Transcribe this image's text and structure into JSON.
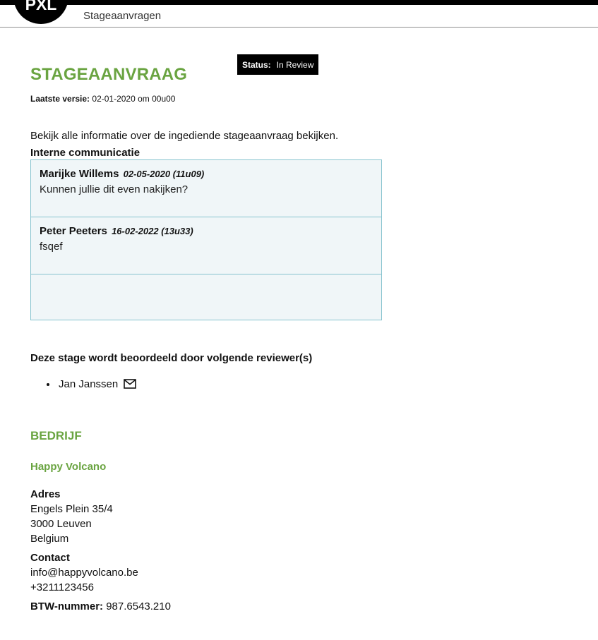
{
  "header": {
    "logo_text": "PXL",
    "app_title": "Stageaanvragen"
  },
  "page": {
    "title": "STAGEAANVRAAG",
    "status_label": "Status:",
    "status_value": "In Review",
    "version_label": "Laatste versie:",
    "version_value": "02-01-2020 om 00u00",
    "intro": "Bekijk alle informatie over de ingediende stageaanvraag bekijken."
  },
  "communication": {
    "title": "Interne communicatie",
    "messages": [
      {
        "author": "Marijke Willems",
        "date": "02-05-2020 (11u09)",
        "text": "Kunnen jullie dit even nakijken?"
      },
      {
        "author": "Peter Peeters",
        "date": "16-02-2022 (13u33)",
        "text": "fsqef"
      }
    ]
  },
  "reviewers": {
    "title": "Deze stage wordt beoordeeld door volgende reviewer(s)",
    "items": [
      {
        "name": "Jan Janssen",
        "icon": "mail-icon"
      }
    ]
  },
  "company": {
    "section_title": "BEDRIJF",
    "name": "Happy Volcano",
    "address_label": "Adres",
    "address_lines": [
      "Engels Plein 35/4",
      "3000 Leuven",
      "Belgium"
    ],
    "contact_label": "Contact",
    "contact_lines": [
      "info@happyvolcano.be",
      "+3211123456"
    ],
    "vat_label": "BTW-nummer:",
    "vat_value": "987.6543.210"
  },
  "colors": {
    "accent": "#6aa441",
    "comment_border": "#87c3cf",
    "comment_bg": "#f0f6f8",
    "header_black": "#000000"
  }
}
